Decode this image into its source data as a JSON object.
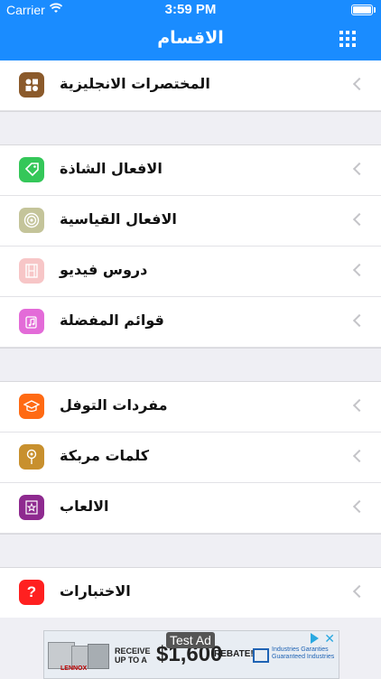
{
  "status_bar": {
    "carrier": "Carrier",
    "time": "3:59 PM"
  },
  "nav": {
    "title": "الاقسام"
  },
  "sections": [
    {
      "items": [
        {
          "label": "المختصرات الانجليزية",
          "icon": "shapes-icon",
          "color": "#8b5a2b"
        }
      ]
    },
    {
      "items": [
        {
          "label": "الافعال الشاذة",
          "icon": "tag-icon",
          "color": "#34c759"
        },
        {
          "label": "الافعال القياسية",
          "icon": "target-icon",
          "color": "#c4c49a"
        },
        {
          "label": "دروس فيديو",
          "icon": "film-icon",
          "color": "#f7c6c7"
        },
        {
          "label": "قوائم المفضلة",
          "icon": "music-notes-icon",
          "color": "#e36bd8"
        }
      ]
    },
    {
      "items": [
        {
          "label": "مفردات التوفل",
          "icon": "graduation-cap-icon",
          "color": "#ff6a13"
        },
        {
          "label": "كلمات مربكة",
          "icon": "location-pin-icon",
          "color": "#c8902e"
        },
        {
          "label": "الالعاب",
          "icon": "trophy-star-icon",
          "color": "#8e2a8f"
        }
      ]
    },
    {
      "items": [
        {
          "label": "الاختبارات",
          "icon": "question-icon",
          "color": "#ff2020"
        }
      ]
    }
  ],
  "ad": {
    "tag": "Test Ad",
    "promo_line1": "RECEIVE",
    "promo_line2": "UP TO A",
    "price": "$1,600",
    "rebate": "REBATE!",
    "brand_line1": "Industries Garanties",
    "brand_line2": "Guaranteed Industries",
    "maker": "LENNOX",
    "close": "✕"
  }
}
